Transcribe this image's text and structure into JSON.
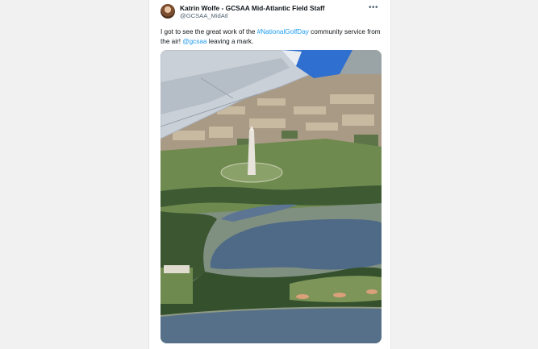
{
  "tweet": {
    "author": {
      "display_name": "Katrin Wolfe - GCSAA Mid-Atlantic Field Staff",
      "handle": "@GCSAA_MidAtl"
    },
    "more_icon": "ellipsis-icon",
    "text": {
      "part1": "I got to see the great work of the ",
      "hashtag": "#NationalGolfDay",
      "part2": " community service from the air! ",
      "mention": "@gcsaa",
      "part3": " leaving a mark."
    },
    "media": {
      "description_icon": "aerial-photo",
      "colors": {
        "water": "#4f6a86",
        "trees": "#3f5a34",
        "grass": "#6e8a4f",
        "wing": "#c9d0d8",
        "wingtip": "#2f6fd0"
      }
    }
  }
}
